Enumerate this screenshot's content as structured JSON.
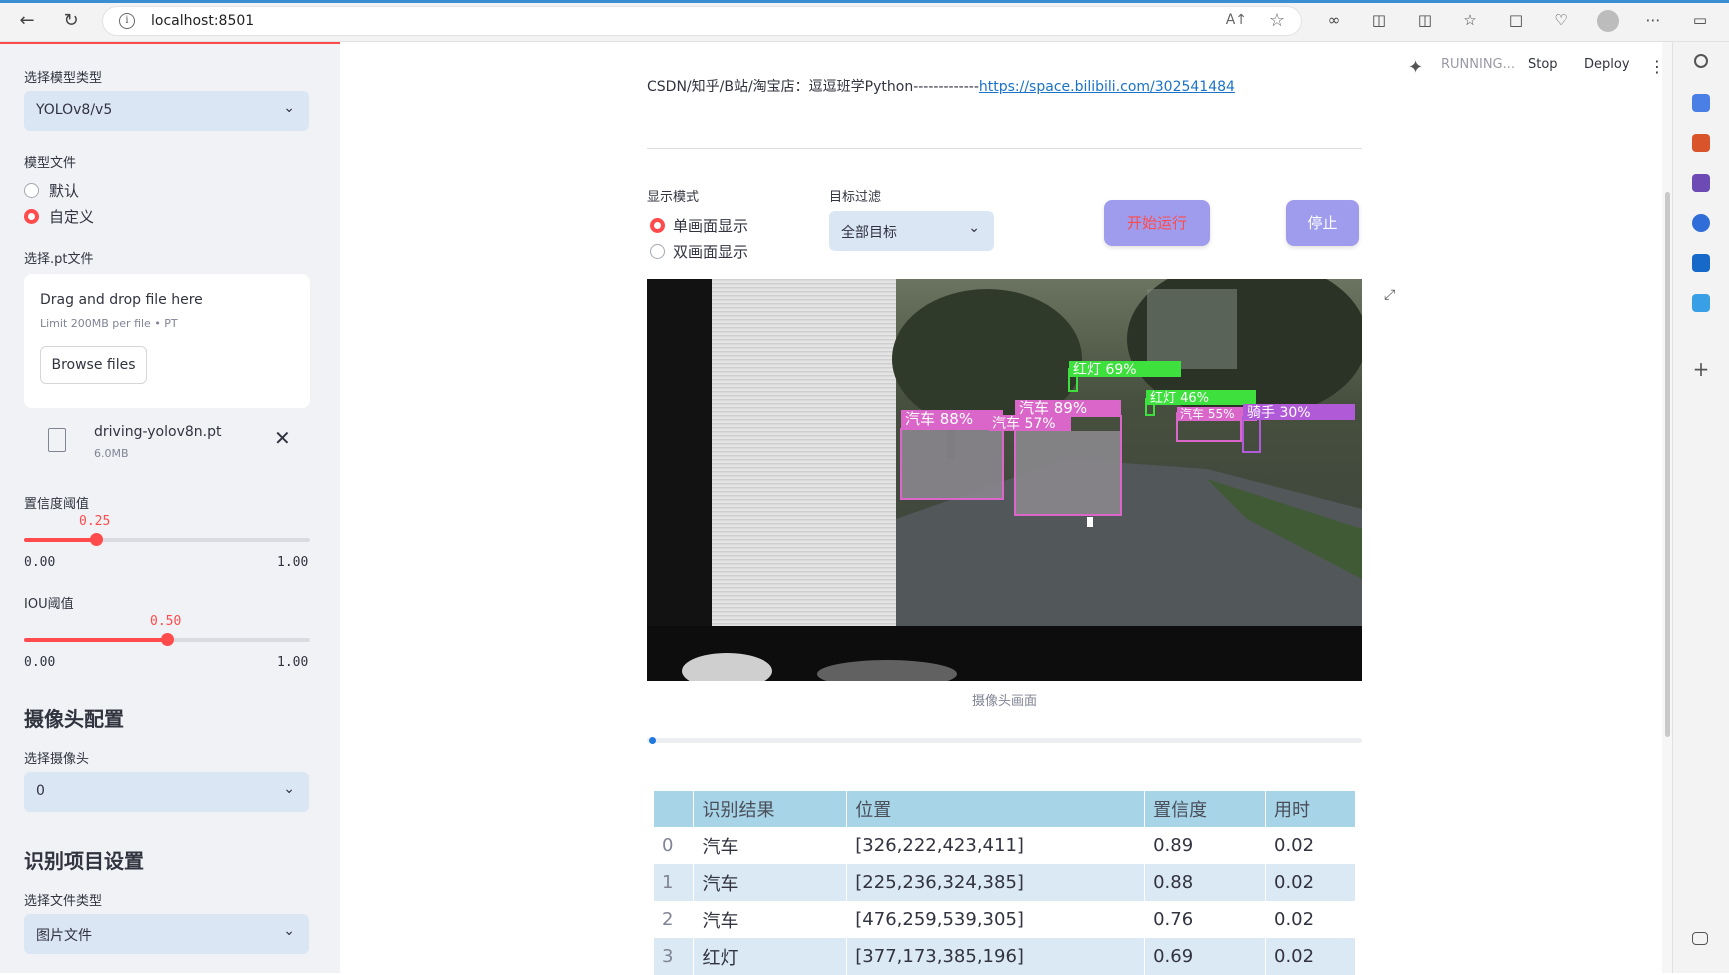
{
  "browser": {
    "url": "localhost:8501",
    "reader_icon": "A↑",
    "star_icon": "☆"
  },
  "app_toolbar": {
    "status": "RUNNING...",
    "stop": "Stop",
    "deploy": "Deploy"
  },
  "sidebar": {
    "model_type_label": "选择模型类型",
    "model_type_value": "YOLOv8/v5",
    "model_file_label": "模型文件",
    "model_file_options": [
      "默认",
      "自定义"
    ],
    "model_file_selected": 1,
    "pt_label": "选择.pt文件",
    "upload": {
      "title": "Drag and drop file here",
      "limit": "Limit 200MB per file • PT",
      "browse": "Browse files"
    },
    "file": {
      "name": "driving-yolov8n.pt",
      "size": "6.0MB"
    },
    "conf": {
      "label": "置信度阈值",
      "value": "0.25",
      "fraction": 0.25,
      "min": "0.00",
      "max": "1.00"
    },
    "iou": {
      "label": "IOU阈值",
      "value": "0.50",
      "fraction": 0.5,
      "min": "0.00",
      "max": "1.00"
    },
    "camera_header": "摄像头配置",
    "camera_label": "选择摄像头",
    "camera_value": "0",
    "recog_header": "识别项目设置",
    "filetype_label": "选择文件类型",
    "filetype_value": "图片文件"
  },
  "main": {
    "top_text_partial": "CSDN/知乎/B站/淘宝店：逗逗班学Python-------------",
    "top_link": "https://space.bilibili.com/302541484",
    "display_mode_label": "显示模式",
    "display_modes": [
      "单画面显示",
      "双画面显示"
    ],
    "display_mode_selected": 0,
    "filter_label": "目标过滤",
    "filter_value": "全部目标",
    "start_button": "开始运行",
    "stop_button": "停止",
    "camera_caption": "摄像头画面",
    "progress": 0.0,
    "detections": [
      {
        "label": "红灯 69%"
      },
      {
        "label": "汽车 89%"
      },
      {
        "label": "汽车 88%"
      },
      {
        "label": "汽车 57%"
      },
      {
        "label": "红灯 46%"
      },
      {
        "label": "骑手 30%"
      },
      {
        "label": "汽车 55%"
      }
    ]
  },
  "table": {
    "headers": [
      "",
      "识别结果",
      "位置",
      "置信度",
      "用时"
    ],
    "rows": [
      [
        "0",
        "汽车",
        "[326,222,423,411]",
        "0.89",
        "0.02"
      ],
      [
        "1",
        "汽车",
        "[225,236,324,385]",
        "0.88",
        "0.02"
      ],
      [
        "2",
        "汽车",
        "[476,259,539,305]",
        "0.76",
        "0.02"
      ],
      [
        "3",
        "红灯",
        "[377,173,385,196]",
        "0.69",
        "0.02"
      ]
    ]
  },
  "colors": {
    "accent": "#ff4b4b",
    "button": "#9f9cee",
    "select_bg": "#dbe6f5",
    "table_header": "#a8d4e8",
    "box_car": "#d966c8",
    "box_light": "#3de03d",
    "box_rider": "#b05ad8"
  }
}
